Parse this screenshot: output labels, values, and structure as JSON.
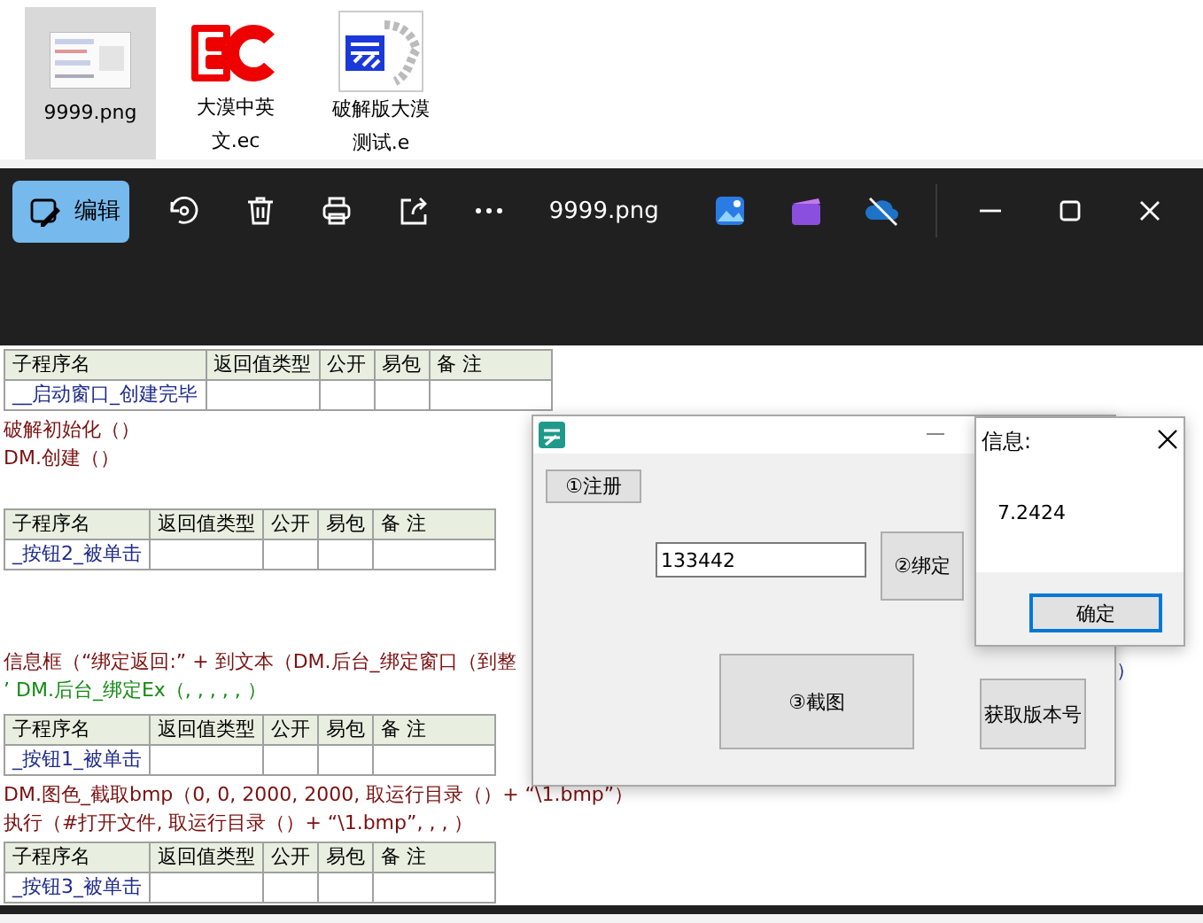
{
  "desktop_icons": [
    {
      "kind": "image",
      "label_lines": [
        "9999.png"
      ],
      "selected": true
    },
    {
      "kind": "ec",
      "label_lines": [
        "大漠中英",
        "文.ec"
      ],
      "selected": false
    },
    {
      "kind": "e",
      "label_lines": [
        "破解版大漠",
        "测试.e"
      ],
      "selected": false
    }
  ],
  "viewer": {
    "edit_button": "编辑",
    "file_name": "9999.png"
  },
  "code": [
    {
      "kind": "table",
      "columns": [
        "子程序名",
        "返回值类型",
        "公开",
        "易包",
        "备 注"
      ],
      "name": "__启动窗口_创建完毕"
    },
    {
      "kind": "line",
      "text": "破解初始化（）"
    },
    {
      "kind": "line",
      "text": "DM.创建（）"
    },
    {
      "kind": "table",
      "columns": [
        "子程序名",
        "返回值类型",
        "公开",
        "易包",
        "备 注"
      ],
      "name": "_按钮2_被单击"
    },
    {
      "kind": "line",
      "text": "信息框（“绑定返回:” + 到文本（DM.后台_绑定窗口（到整"
    },
    {
      "kind": "comment",
      "text": "’ DM.后台_绑定Ex（, , , , , ）"
    },
    {
      "kind": "table",
      "columns": [
        "子程序名",
        "返回值类型",
        "公开",
        "易包",
        "备 注"
      ],
      "name": "_按钮1_被单击"
    },
    {
      "kind": "line",
      "text": "DM.图色_截取bmp（0, 0, 2000, 2000, 取运行目录（）+ “\\1.bmp”）"
    },
    {
      "kind": "line",
      "text": "执行（#打开文件, 取运行目录（）+ “\\1.bmp”, , , ）"
    },
    {
      "kind": "table",
      "columns": [
        "子程序名",
        "返回值类型",
        "公开",
        "易包",
        "备 注"
      ],
      "name": "_按钮3_被单击"
    }
  ],
  "code_tail": "）",
  "app_window": {
    "register_button": "①注册",
    "input_value": "133442",
    "bind_button": "②绑定",
    "screenshot_button": "③截图",
    "version_button": "获取版本号"
  },
  "message_box": {
    "title": "信息:",
    "message": "7.2424",
    "button": "确定"
  }
}
